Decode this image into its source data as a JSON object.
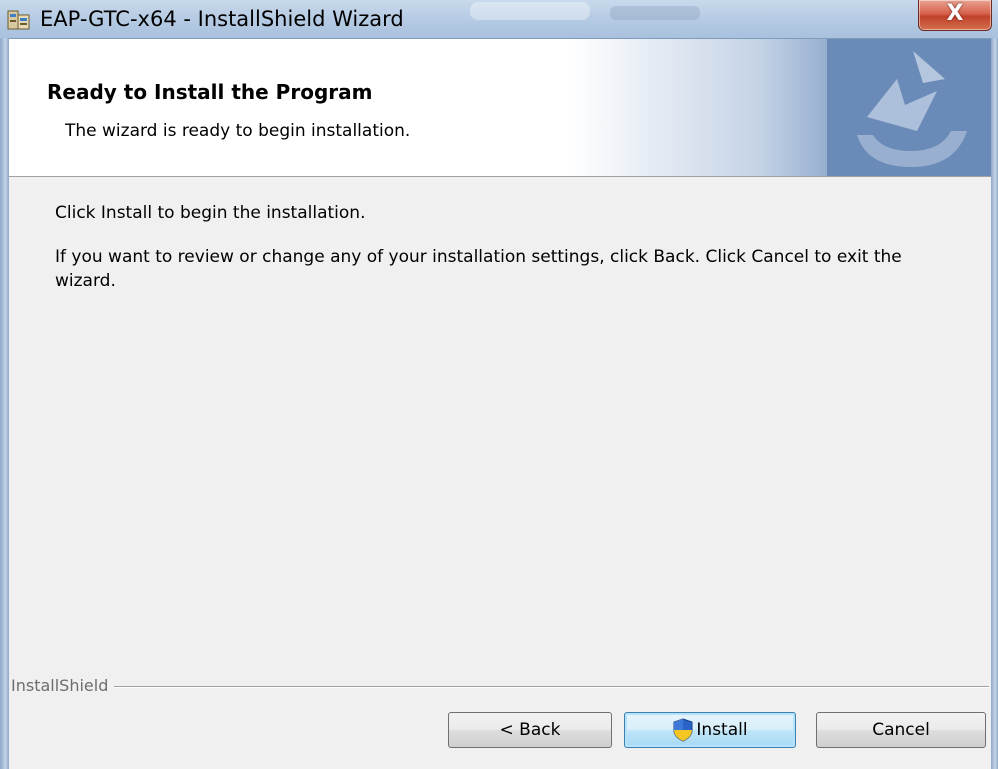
{
  "window": {
    "title": "EAP-GTC-x64 - InstallShield Wizard",
    "close_label": "X",
    "app_icon": "installer-icon"
  },
  "banner": {
    "title": "Ready to Install the Program",
    "subtitle": "The wizard is ready to begin installation."
  },
  "body": {
    "line1": "Click Install to begin the installation.",
    "line2": "If you want to review or change any of your installation settings, click Back. Click Cancel to exit the wizard."
  },
  "footer": {
    "brand": "InstallShield",
    "buttons": {
      "back": "< Back",
      "install": "Install",
      "cancel": "Cancel"
    }
  },
  "colors": {
    "banner_accent": "#6a8bb8",
    "close_button": "#c9412c",
    "default_button_border": "#3c7fb1"
  }
}
